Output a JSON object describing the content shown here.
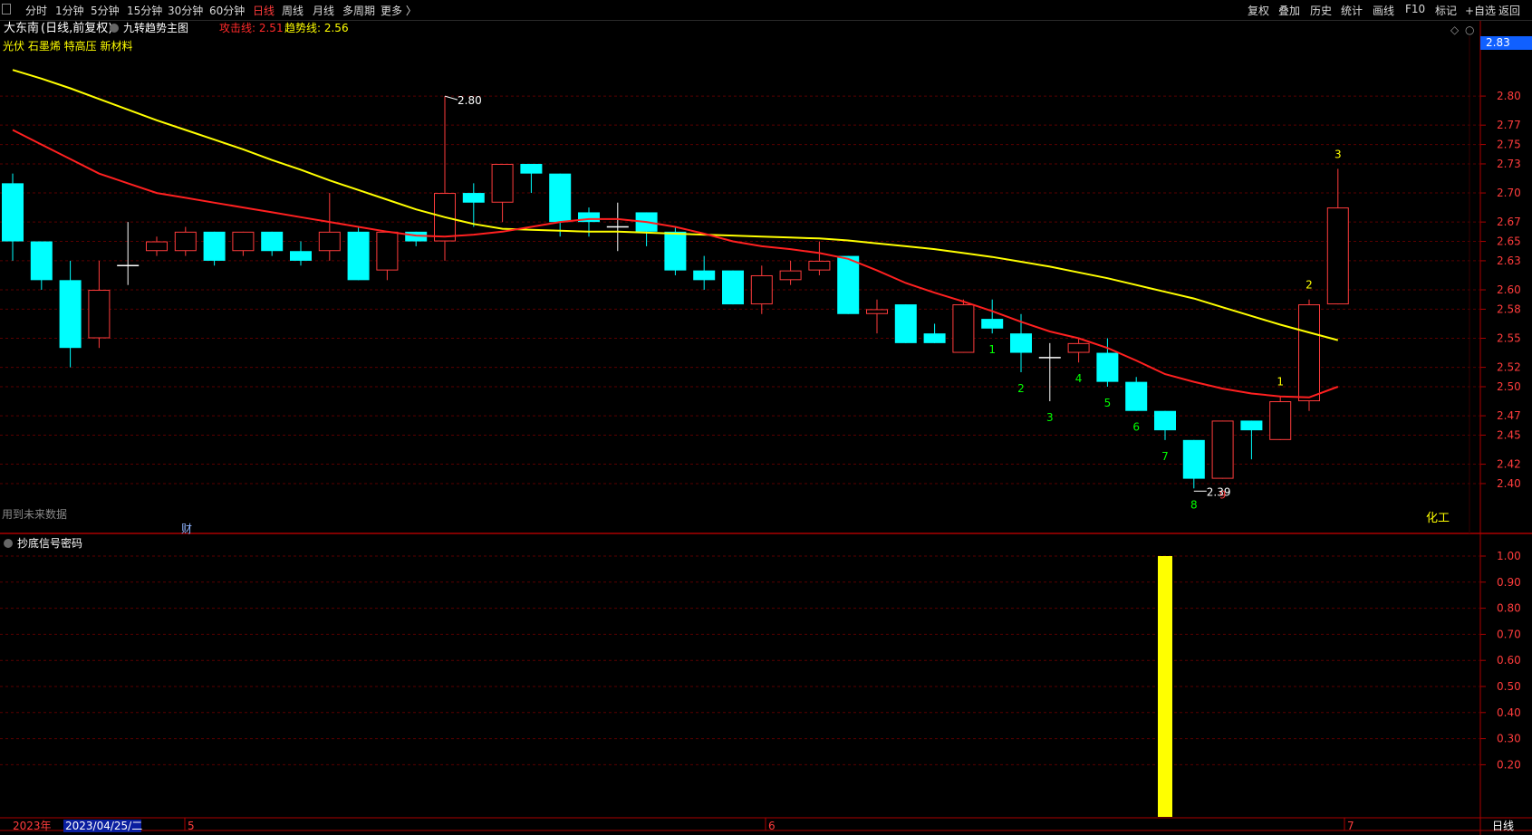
{
  "toolbar": {
    "left_items": [
      "分时",
      "1分钟",
      "5分钟",
      "15分钟",
      "30分钟",
      "60分钟",
      "日线",
      "周线",
      "月线",
      "多周期",
      "更多 〉"
    ],
    "active_item": "日线",
    "right_items": [
      "复权",
      "叠加",
      "历史",
      "统计",
      "画线",
      "F10",
      "标记",
      "+自选",
      "返回"
    ]
  },
  "header": {
    "stock_name": "大东南",
    "chart_mode": "(日线,前复权)",
    "indicator_name": "九转趋势主图",
    "attack_line": "攻击线: 2.51",
    "trend_line": "趋势线: 2.56",
    "concepts": "光伏 石墨烯 特高压 新材料"
  },
  "main_chart": {
    "price_tag": "2.83",
    "high_label": "2.80",
    "low_label": "2.39",
    "future_data_note": "用到未来数据",
    "finance_marker": "财",
    "sector_label": "化工",
    "y_ticks": [
      "2.80",
      "2.77",
      "2.75",
      "2.73",
      "2.70",
      "2.67",
      "2.65",
      "2.63",
      "2.60",
      "2.58",
      "2.55",
      "2.52",
      "2.50",
      "2.47",
      "2.45",
      "2.42",
      "2.40"
    ]
  },
  "sub_chart": {
    "title": "抄底信号密码",
    "y_ticks": [
      "1.00",
      "0.90",
      "0.80",
      "0.70",
      "0.60",
      "0.50",
      "0.40",
      "0.30",
      "0.20"
    ],
    "bar_value": 1.0,
    "bar_color": "#ffff00"
  },
  "x_axis": {
    "year_label": "2023年",
    "date_cursor": "2023/04/25/二",
    "month_labels": [
      "5",
      "6",
      "7"
    ],
    "period_label": "日线"
  },
  "colors": {
    "up": "#ff3c3c",
    "down": "#00ffff",
    "attack_line": "#ff2020",
    "trend_line": "#ffff00",
    "grid": "#5a0000"
  },
  "chart_data": {
    "type": "candlestick",
    "ylim": [
      2.385,
      2.83
    ],
    "candles": [
      {
        "o": 2.71,
        "h": 2.72,
        "l": 2.63,
        "c": 2.65
      },
      {
        "o": 2.65,
        "h": 2.65,
        "l": 2.6,
        "c": 2.61
      },
      {
        "o": 2.61,
        "h": 2.63,
        "l": 2.52,
        "c": 2.54
      },
      {
        "o": 2.55,
        "h": 2.63,
        "l": 2.54,
        "c": 2.6
      },
      {
        "o": 2.625,
        "h": 2.67,
        "l": 2.605,
        "c": 2.625
      },
      {
        "o": 2.64,
        "h": 2.655,
        "l": 2.635,
        "c": 2.65
      },
      {
        "o": 2.64,
        "h": 2.665,
        "l": 2.635,
        "c": 2.66
      },
      {
        "o": 2.66,
        "h": 2.66,
        "l": 2.625,
        "c": 2.63
      },
      {
        "o": 2.64,
        "h": 2.66,
        "l": 2.635,
        "c": 2.66
      },
      {
        "o": 2.66,
        "h": 2.66,
        "l": 2.635,
        "c": 2.64
      },
      {
        "o": 2.64,
        "h": 2.65,
        "l": 2.625,
        "c": 2.63
      },
      {
        "o": 2.64,
        "h": 2.7,
        "l": 2.63,
        "c": 2.66
      },
      {
        "o": 2.66,
        "h": 2.665,
        "l": 2.61,
        "c": 2.61
      },
      {
        "o": 2.62,
        "h": 2.66,
        "l": 2.61,
        "c": 2.66
      },
      {
        "o": 2.66,
        "h": 2.66,
        "l": 2.645,
        "c": 2.65
      },
      {
        "o": 2.65,
        "h": 2.8,
        "l": 2.63,
        "c": 2.7
      },
      {
        "o": 2.7,
        "h": 2.71,
        "l": 2.665,
        "c": 2.69
      },
      {
        "o": 2.69,
        "h": 2.73,
        "l": 2.67,
        "c": 2.73
      },
      {
        "o": 2.73,
        "h": 2.73,
        "l": 2.7,
        "c": 2.72
      },
      {
        "o": 2.72,
        "h": 2.72,
        "l": 2.655,
        "c": 2.67
      },
      {
        "o": 2.68,
        "h": 2.685,
        "l": 2.655,
        "c": 2.67
      },
      {
        "o": 2.665,
        "h": 2.69,
        "l": 2.64,
        "c": 2.665
      },
      {
        "o": 2.68,
        "h": 2.68,
        "l": 2.645,
        "c": 2.66
      },
      {
        "o": 2.66,
        "h": 2.665,
        "l": 2.615,
        "c": 2.62
      },
      {
        "o": 2.62,
        "h": 2.635,
        "l": 2.6,
        "c": 2.61
      },
      {
        "o": 2.62,
        "h": 2.62,
        "l": 2.585,
        "c": 2.585
      },
      {
        "o": 2.585,
        "h": 2.625,
        "l": 2.575,
        "c": 2.615
      },
      {
        "o": 2.61,
        "h": 2.63,
        "l": 2.605,
        "c": 2.62
      },
      {
        "o": 2.62,
        "h": 2.65,
        "l": 2.615,
        "c": 2.63
      },
      {
        "o": 2.635,
        "h": 2.635,
        "l": 2.575,
        "c": 2.575
      },
      {
        "o": 2.575,
        "h": 2.59,
        "l": 2.555,
        "c": 2.58
      },
      {
        "o": 2.585,
        "h": 2.585,
        "l": 2.545,
        "c": 2.545
      },
      {
        "o": 2.555,
        "h": 2.565,
        "l": 2.545,
        "c": 2.545
      },
      {
        "o": 2.535,
        "h": 2.59,
        "l": 2.535,
        "c": 2.585
      },
      {
        "o": 2.57,
        "h": 2.59,
        "l": 2.555,
        "c": 2.56
      },
      {
        "o": 2.555,
        "h": 2.575,
        "l": 2.515,
        "c": 2.535
      },
      {
        "o": 2.53,
        "h": 2.545,
        "l": 2.485,
        "c": 2.53
      },
      {
        "o": 2.535,
        "h": 2.55,
        "l": 2.525,
        "c": 2.545
      },
      {
        "o": 2.535,
        "h": 2.55,
        "l": 2.5,
        "c": 2.505
      },
      {
        "o": 2.505,
        "h": 2.51,
        "l": 2.475,
        "c": 2.475
      },
      {
        "o": 2.475,
        "h": 2.475,
        "l": 2.445,
        "c": 2.455
      },
      {
        "o": 2.445,
        "h": 2.445,
        "l": 2.395,
        "c": 2.405
      },
      {
        "o": 2.405,
        "h": 2.465,
        "l": 2.405,
        "c": 2.465
      },
      {
        "o": 2.465,
        "h": 2.465,
        "l": 2.425,
        "c": 2.455
      },
      {
        "o": 2.445,
        "h": 2.49,
        "l": 2.445,
        "c": 2.485
      },
      {
        "o": 2.485,
        "h": 2.59,
        "l": 2.475,
        "c": 2.585
      },
      {
        "o": 2.585,
        "h": 2.725,
        "l": 2.585,
        "c": 2.685
      }
    ],
    "countdown_labels": [
      {
        "i": 34,
        "text": "1",
        "color": "#00ff00"
      },
      {
        "i": 35,
        "text": "2",
        "color": "#00ff00"
      },
      {
        "i": 36,
        "text": "3",
        "color": "#00ff00"
      },
      {
        "i": 37,
        "text": "4",
        "color": "#00ff00"
      },
      {
        "i": 38,
        "text": "5",
        "color": "#00ff00"
      },
      {
        "i": 39,
        "text": "6",
        "color": "#00ff00"
      },
      {
        "i": 40,
        "text": "7",
        "color": "#00ff00"
      },
      {
        "i": 41,
        "text": "8",
        "color": "#00ff00"
      },
      {
        "i": 42,
        "text": "9",
        "color": "#ff4040"
      },
      {
        "i": 44,
        "text": "1",
        "color": "#ffff00"
      },
      {
        "i": 45,
        "text": "2",
        "color": "#ffff00"
      },
      {
        "i": 46,
        "text": "3",
        "color": "#ffff00"
      }
    ],
    "attack_line_values": [
      2.765,
      2.75,
      2.735,
      2.72,
      2.71,
      2.7,
      2.695,
      2.69,
      2.685,
      2.68,
      2.675,
      2.67,
      2.665,
      2.66,
      2.656,
      2.655,
      2.657,
      2.66,
      2.665,
      2.67,
      2.673,
      2.673,
      2.67,
      2.665,
      2.658,
      2.65,
      2.645,
      2.642,
      2.638,
      2.632,
      2.62,
      2.607,
      2.597,
      2.588,
      2.578,
      2.567,
      2.557,
      2.55,
      2.54,
      2.527,
      2.513,
      2.505,
      2.498,
      2.493,
      2.49,
      2.489,
      2.5
    ],
    "trend_line_values": [
      2.827,
      2.818,
      2.808,
      2.797,
      2.786,
      2.775,
      2.765,
      2.755,
      2.745,
      2.734,
      2.724,
      2.713,
      2.703,
      2.693,
      2.683,
      2.675,
      2.668,
      2.663,
      2.662,
      2.661,
      2.66,
      2.66,
      2.659,
      2.658,
      2.657,
      2.656,
      2.655,
      2.654,
      2.653,
      2.651,
      2.648,
      2.645,
      2.642,
      2.638,
      2.634,
      2.629,
      2.624,
      2.618,
      2.612,
      2.605,
      2.598,
      2.591,
      2.582,
      2.573,
      2.564,
      2.556,
      2.548
    ]
  }
}
